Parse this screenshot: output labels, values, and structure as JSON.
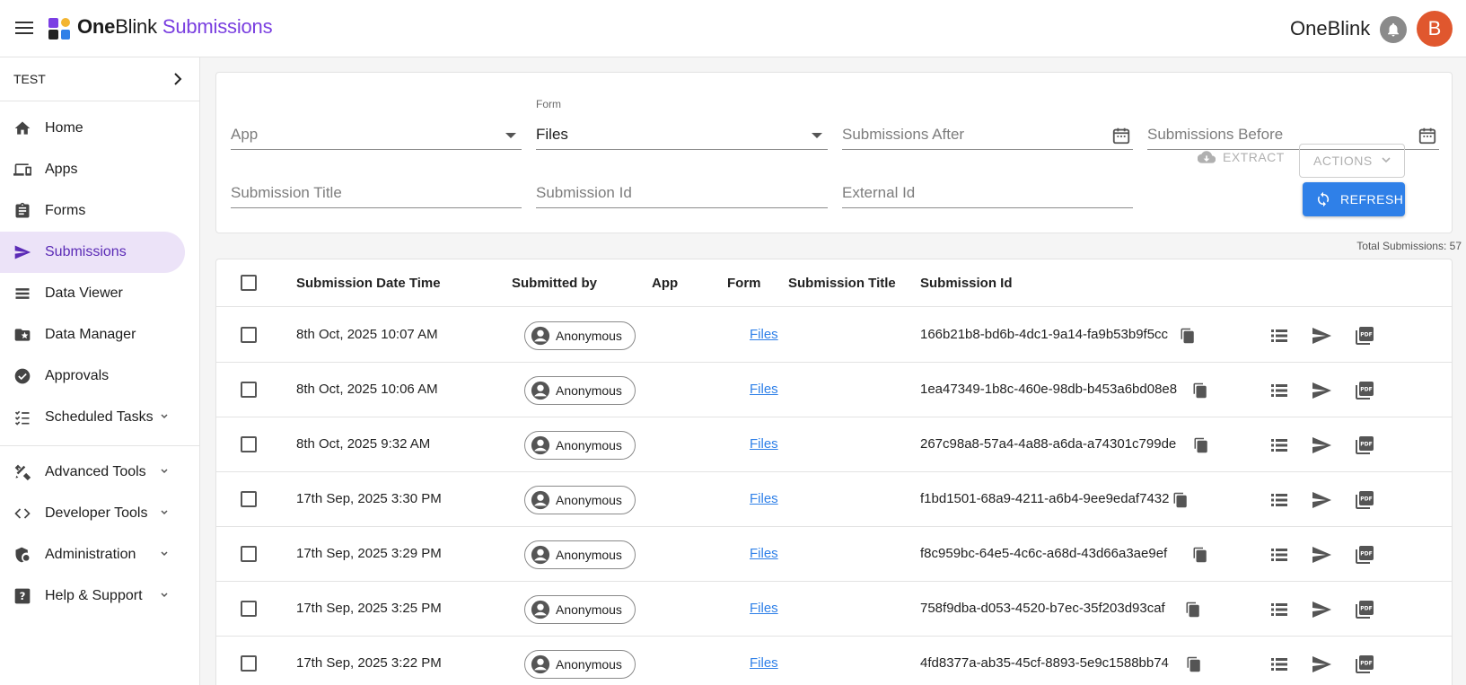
{
  "header": {
    "brand_one": "One",
    "brand_blink": "Blink",
    "brand_product": "Submissions",
    "org_name": "OneBlink",
    "avatar_initial": "B",
    "logo_colors": [
      "#7b3fe4",
      "#f3b531",
      "#2f80e8",
      "#e0572e"
    ]
  },
  "sidebar": {
    "environment": "TEST",
    "items": [
      {
        "label": "Home",
        "icon": "home-icon"
      },
      {
        "label": "Apps",
        "icon": "devices-icon"
      },
      {
        "label": "Forms",
        "icon": "clipboard-icon"
      },
      {
        "label": "Submissions",
        "icon": "send-icon",
        "active": true
      },
      {
        "label": "Data Viewer",
        "icon": "list-view-icon"
      },
      {
        "label": "Data Manager",
        "icon": "folder-star-icon"
      },
      {
        "label": "Approvals",
        "icon": "check-circle-icon"
      },
      {
        "label": "Scheduled Tasks",
        "icon": "checklist-icon",
        "expandable": true
      }
    ],
    "items2": [
      {
        "label": "Advanced Tools",
        "icon": "tools-icon",
        "expandable": true
      },
      {
        "label": "Developer Tools",
        "icon": "code-icon",
        "expandable": true
      },
      {
        "label": "Administration",
        "icon": "admin-icon",
        "expandable": true
      },
      {
        "label": "Help & Support",
        "icon": "help-icon",
        "expandable": true
      }
    ]
  },
  "filters": {
    "app_label": "App",
    "form_label": "Form",
    "form_value": "Files",
    "after_label": "Submissions After",
    "before_label": "Submissions Before",
    "title_label": "Submission Title",
    "id_label": "Submission Id",
    "external_label": "External Id",
    "extract_label": "EXTRACT",
    "actions_label": "ACTIONS",
    "refresh_label": "REFRESH"
  },
  "total_label": "Total Submissions: 57",
  "table": {
    "columns": [
      "Submission Date Time",
      "Submitted by",
      "App",
      "Form",
      "Submission Title",
      "Submission Id"
    ],
    "rows": [
      {
        "date": "8th Oct, 2025 10:07 AM",
        "by": "Anonymous",
        "app": "",
        "form": "Files",
        "title": "",
        "id": "166b21b8-bd6b-4dc1-9a14-fa9b53b9f5cc"
      },
      {
        "date": "8th Oct, 2025 10:06 AM",
        "by": "Anonymous",
        "app": "",
        "form": "Files",
        "title": "",
        "id": "1ea47349-1b8c-460e-98db-b453a6bd08e8"
      },
      {
        "date": "8th Oct, 2025 9:32 AM",
        "by": "Anonymous",
        "app": "",
        "form": "Files",
        "title": "",
        "id": "267c98a8-57a4-4a88-a6da-a74301c799de"
      },
      {
        "date": "17th Sep, 2025 3:30 PM",
        "by": "Anonymous",
        "app": "",
        "form": "Files",
        "title": "",
        "id": "f1bd1501-68a9-4211-a6b4-9ee9edaf7432"
      },
      {
        "date": "17th Sep, 2025 3:29 PM",
        "by": "Anonymous",
        "app": "",
        "form": "Files",
        "title": "",
        "id": "f8c959bc-64e5-4c6c-a68d-43d66a3ae9ef"
      },
      {
        "date": "17th Sep, 2025 3:25 PM",
        "by": "Anonymous",
        "app": "",
        "form": "Files",
        "title": "",
        "id": "758f9dba-d053-4520-b7ec-35f203d93caf"
      },
      {
        "date": "17th Sep, 2025 3:22 PM",
        "by": "Anonymous",
        "app": "",
        "form": "Files",
        "title": "",
        "id": "4fd8377a-ab35-45cf-8893-5e9c1588bb74"
      }
    ]
  }
}
